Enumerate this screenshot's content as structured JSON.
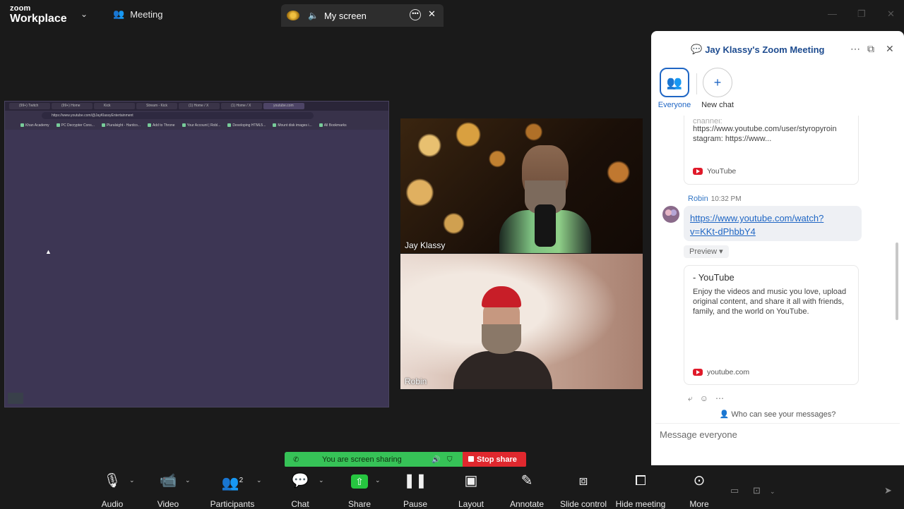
{
  "topbar": {
    "logo_line1": "zoom",
    "logo_line2": "Workplace",
    "meeting_tab": "Meeting",
    "screen_tab": "My screen"
  },
  "shared_screen": {
    "browser_tabs": [
      "(99+) Twitch",
      "(99+) Home",
      "Kick",
      "Stream - Kick",
      "(1) Home / X",
      "(1) Home / X",
      "youtube.com"
    ],
    "url": "https://www.youtube.com/@JayKlassyEntertainment",
    "bookmarks": [
      "Khan Academy",
      "PC Decrypter Cons...",
      "Pluralsight - Hardco...",
      "Add to Throne",
      "Your Account | Robl...",
      "Developing HTML5...",
      "Mount disk images i...",
      "All Bookmarks"
    ]
  },
  "videos": [
    {
      "name": "Jay Klassy"
    },
    {
      "name": "Robin"
    }
  ],
  "chat": {
    "title": "Jay Klassy's Zoom Meeting",
    "channels": [
      {
        "label": "Everyone"
      },
      {
        "label": "New chat"
      }
    ],
    "card1": {
      "text_partial": "channel:",
      "text_line1": "https://www.youtube.com/user/styropyroin",
      "text_line2": "stagram: https://www...",
      "source": "YouTube"
    },
    "message": {
      "sender": "Robin",
      "time": "10:32 PM",
      "link_line1": "https://www.youtube.com/watch?",
      "link_line2": "v=KKt-dPhbbY4",
      "preview_label": "Preview ▾"
    },
    "card2": {
      "title": "- YouTube",
      "desc_line1": "Enjoy the videos and music you love, upload",
      "desc_line2": "original content, and share it all with friends,",
      "desc_line3": "family, and the world on YouTube.",
      "source": "youtube.com"
    },
    "who_can_see": "Who can see your messages?",
    "placeholder": "Message everyone"
  },
  "sharing": {
    "status": "You are screen sharing",
    "stop": "Stop share"
  },
  "toolbar": {
    "participants_count": "2",
    "items": [
      "Audio",
      "Video",
      "Participants",
      "Chat",
      "Share",
      "Pause",
      "Layout",
      "Annotate",
      "Slide control",
      "Hide meeting",
      "More"
    ]
  },
  "colors": {
    "accent": "#1f66c4",
    "share_green": "#36c257",
    "stop_red": "#e0282e",
    "shared_bg": "#3d3654"
  }
}
